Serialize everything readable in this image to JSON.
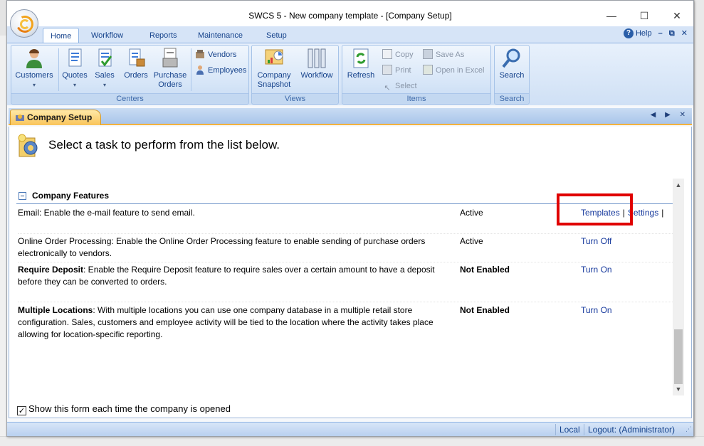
{
  "window": {
    "title": "SWCS 5 - New company template - [Company Setup]",
    "min_glyph": "—",
    "max_glyph": "☐",
    "close_glyph": "✕"
  },
  "ribbon": {
    "tabs": [
      {
        "label": "Home",
        "active": true
      },
      {
        "label": "Workflow"
      },
      {
        "label": "Reports"
      },
      {
        "label": "Maintenance"
      },
      {
        "label": "Setup"
      }
    ],
    "help_label": "Help",
    "help_glyph": "?",
    "mini_glyphs": [
      "–",
      "⧉",
      "✕"
    ],
    "groups": {
      "centers": {
        "label": "Centers",
        "customers": "Customers",
        "quotes": "Quotes",
        "sales": "Sales",
        "orders": "Orders",
        "purchase_orders_line1": "Purchase",
        "purchase_orders_line2": "Orders",
        "vendors": "Vendors",
        "employees": "Employees"
      },
      "views": {
        "label": "Views",
        "company_snapshot_line1": "Company",
        "company_snapshot_line2": "Snapshot",
        "workflow": "Workflow"
      },
      "items": {
        "label": "Items",
        "refresh": "Refresh",
        "copy": "Copy",
        "print": "Print",
        "select": "Select",
        "save_as": "Save As",
        "open_in_excel": "Open in Excel"
      },
      "search": {
        "label": "Search",
        "search": "Search"
      }
    }
  },
  "doc_tab": {
    "label": "Company Setup",
    "nav_glyphs": "◀ ▶ ✕"
  },
  "content": {
    "header": "Select a task to perform from the list below.",
    "section_title": "Company Features",
    "rows": [
      {
        "title": "",
        "text": "Email: Enable the e-mail feature to send email.",
        "status": "Active",
        "actions": [
          "Templates",
          "Settings"
        ]
      },
      {
        "title": "",
        "text": "Online Order Processing: Enable the Online Order Processing feature to enable sending of purchase orders electronically to vendors.",
        "status": "Active",
        "actions": [
          "Turn Off"
        ]
      },
      {
        "title": "Require Deposit",
        "text": ": Enable the Require Deposit feature to require sales over a certain amount to have a deposit before they can be converted to orders.",
        "status": "Not Enabled",
        "actions": [
          "Turn On"
        ]
      },
      {
        "title": "Multiple Locations",
        "text": ": With multiple locations you can use one company database in a multiple retail store configuration. Sales, customers and employee activity will be tied to the location where the activity takes place allowing for location-specific reporting.",
        "status": "Not Enabled",
        "actions": [
          "Turn On"
        ]
      }
    ],
    "show_form_label": "Show this form each time the company is opened",
    "show_form_checked": true
  },
  "statusbar": {
    "local": "Local",
    "logout": "Logout: (Administrator)"
  },
  "colors": {
    "link": "#15389c",
    "highlight_box": "#e00000",
    "ribbon_text": "#15428b"
  }
}
